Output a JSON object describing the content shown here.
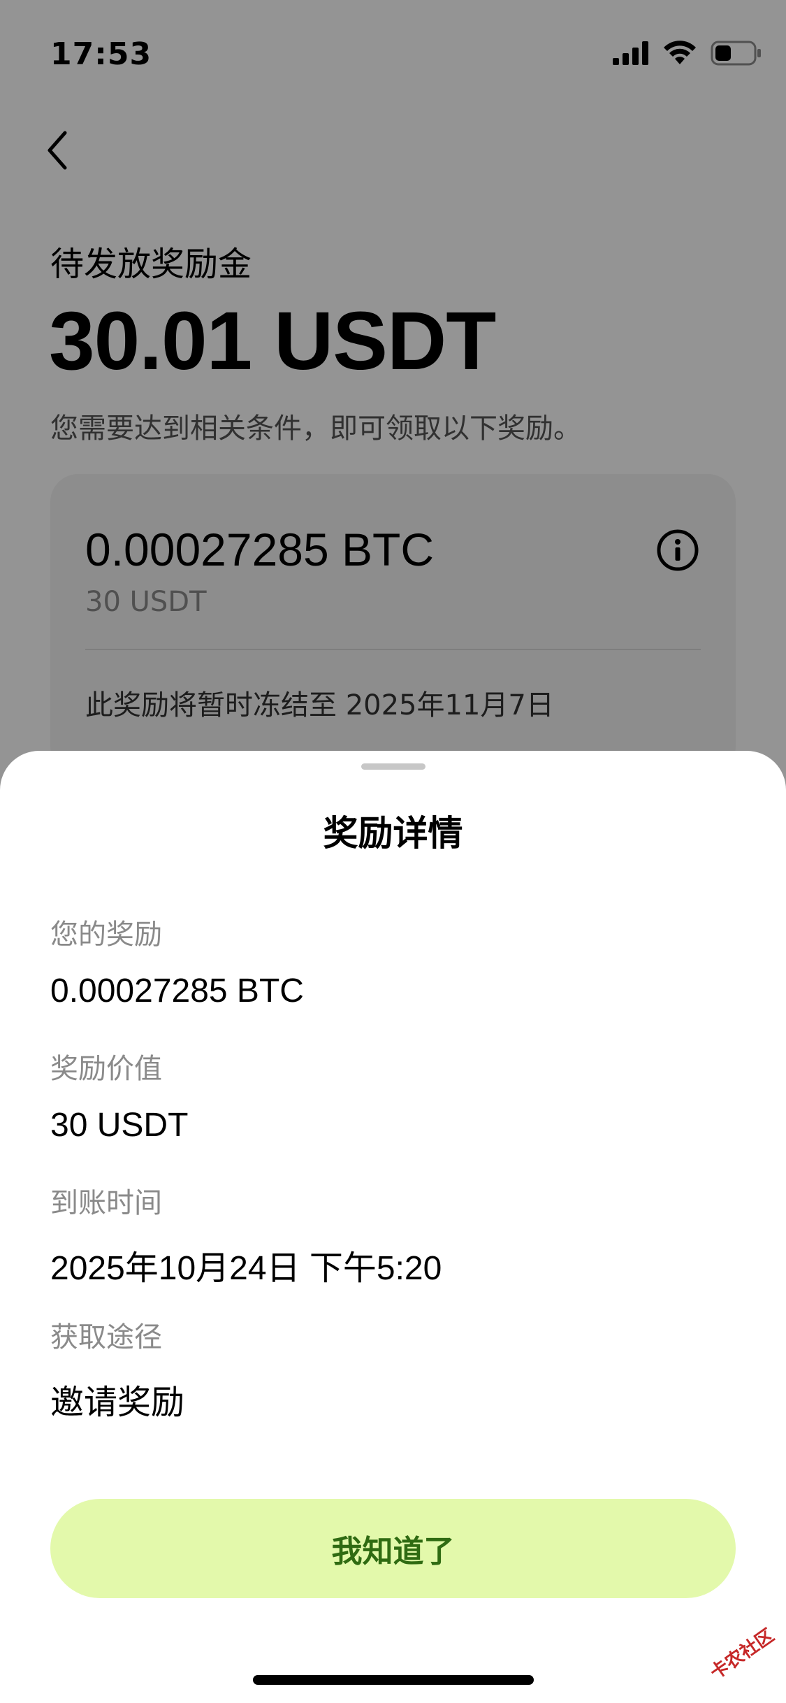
{
  "status_bar": {
    "time": "17:53",
    "icons": [
      "cellular-signal-icon",
      "wifi-icon",
      "battery-icon"
    ]
  },
  "page": {
    "back_icon": "chevron-left-icon",
    "subtitle": "待发放奖励金",
    "amount": "30.01 USDT",
    "description": "您需要达到相关条件，即可领取以下奖励。",
    "card": {
      "btc_amount": "0.00027285 BTC",
      "usdt_value": "30 USDT",
      "info_icon": "info-icon",
      "freeze_text": "此奖励将暂时冻结至 2025年11月7日"
    }
  },
  "sheet": {
    "title": "奖励详情",
    "details": [
      {
        "label": "您的奖励",
        "value": "0.00027285 BTC"
      },
      {
        "label": "奖励价值",
        "value": "30 USDT"
      },
      {
        "label": "到账时间",
        "value": "2025年10月24日 下午5:20"
      },
      {
        "label": "获取途径",
        "value": "邀请奖励"
      }
    ],
    "confirm_button": "我知道了"
  },
  "watermark": "卡农社区",
  "colors": {
    "button_bg": "#e3f9ab",
    "button_text": "#2f6b12",
    "overlay": "rgba(0,0,0,0.42)"
  }
}
